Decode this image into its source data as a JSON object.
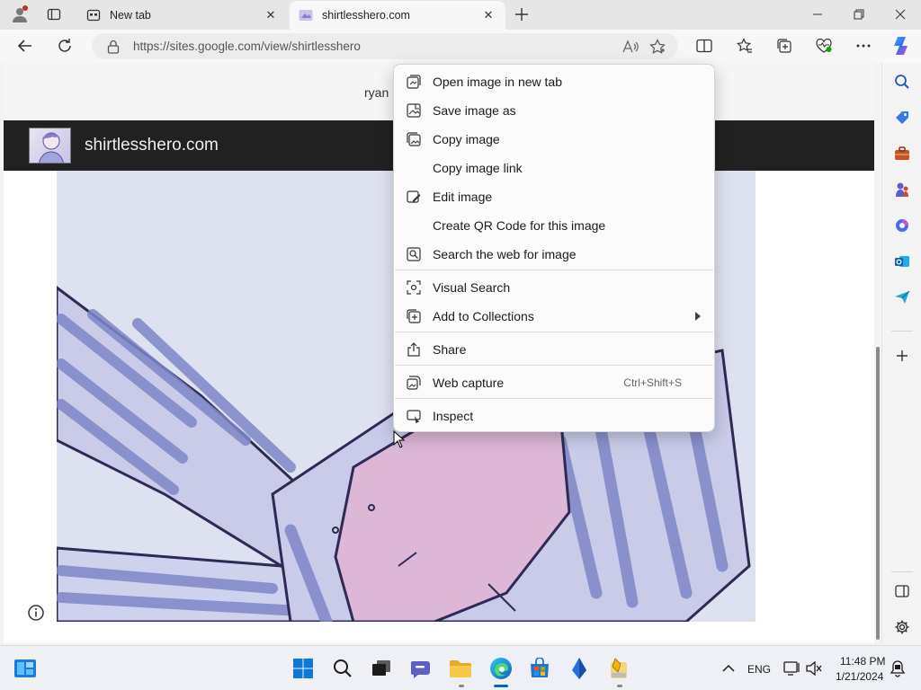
{
  "browser": {
    "tabs": [
      {
        "title": "New tab",
        "active": false
      },
      {
        "title": "shirtlesshero.com",
        "active": true
      }
    ],
    "address": {
      "url": "https://sites.google.com/view/shirtlesshero"
    }
  },
  "page": {
    "owner_text": "ryan",
    "site_title": "shirtlesshero.com"
  },
  "context_menu": {
    "groups": [
      [
        {
          "label": "Open image in new tab",
          "icon": "open-new-tab-icon"
        },
        {
          "label": "Save image as",
          "icon": "save-image-icon"
        },
        {
          "label": "Copy image",
          "icon": "copy-image-icon"
        },
        {
          "label": "Copy image link",
          "icon": ""
        },
        {
          "label": "Edit image",
          "icon": "edit-image-icon"
        },
        {
          "label": "Create QR Code for this image",
          "icon": ""
        },
        {
          "label": "Search the web for image",
          "icon": "search-image-icon"
        }
      ],
      [
        {
          "label": "Visual Search",
          "icon": "visual-search-icon"
        },
        {
          "label": "Add to Collections",
          "icon": "collections-icon",
          "submenu": true
        }
      ],
      [
        {
          "label": "Share",
          "icon": "share-icon"
        }
      ],
      [
        {
          "label": "Web capture",
          "icon": "web-capture-icon",
          "shortcut": "Ctrl+Shift+S"
        }
      ],
      [
        {
          "label": "Inspect",
          "icon": "inspect-icon"
        }
      ]
    ]
  },
  "taskbar": {
    "language": "ENG",
    "time": "11:48 PM",
    "date": "1/21/2024"
  },
  "colors": {
    "accent": "#0067c0",
    "site_header": "#212121",
    "art_stripe": "#7f86c8",
    "art_skin": "#dcb7d6"
  }
}
